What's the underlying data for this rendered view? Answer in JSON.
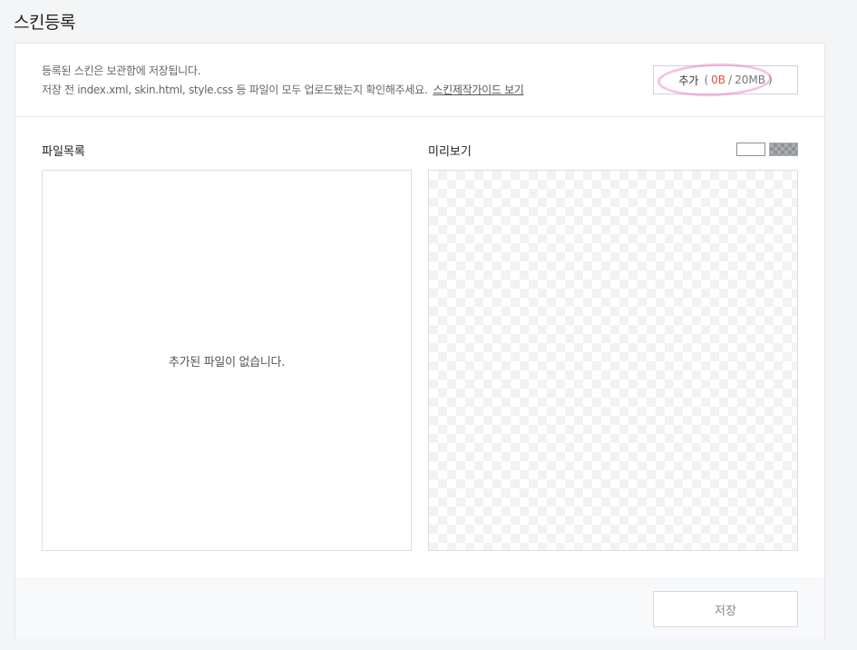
{
  "page": {
    "title": "스킨등록"
  },
  "info": {
    "line1": "등록된 스킨은 보관함에 저장됩니다.",
    "line2": "저장 전 index.xml, skin.html, style.css 등 파일이 모두 업로드됐는지 확인해주세요.",
    "guide_link": "스킨제작가이드 보기"
  },
  "add_button": {
    "label": "추가",
    "open_paren": "(",
    "used": "0B",
    "separator": "/",
    "limit": "20MB",
    "close_paren": ")"
  },
  "file_list": {
    "label": "파일목록",
    "empty_message": "추가된 파일이 없습니다."
  },
  "preview": {
    "label": "미리보기"
  },
  "footer": {
    "save_label": "저장"
  },
  "colors": {
    "accent_used": "#e4503c",
    "highlight": "#e678be"
  }
}
